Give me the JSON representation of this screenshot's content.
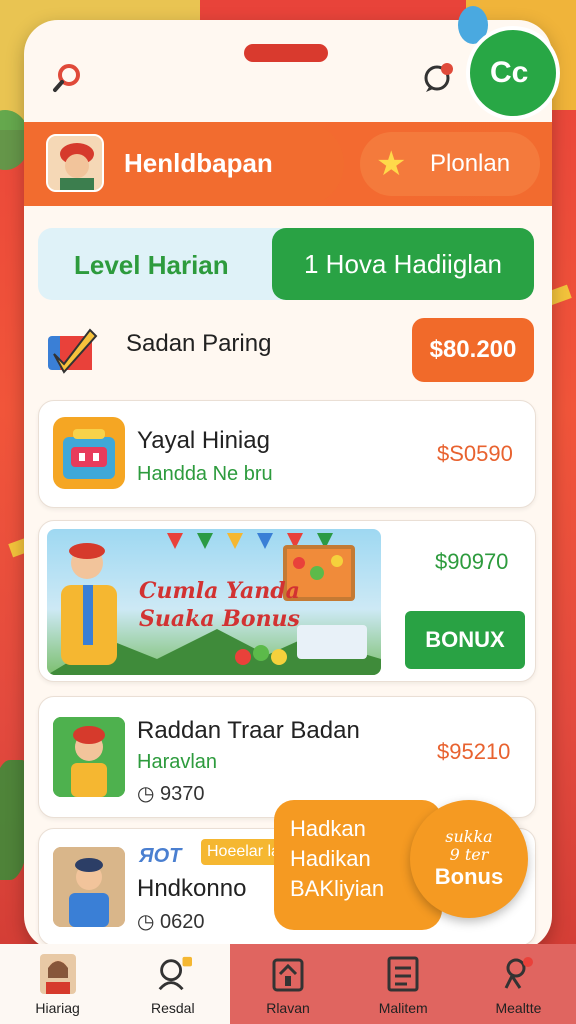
{
  "topbar": {
    "search_icon": "search-icon",
    "chat_icon": "chat-icon"
  },
  "header": {
    "title": "Henldbapan",
    "right_label": "Plonlan"
  },
  "level": {
    "label": "Level Harian",
    "reward_button": "1 Hova Hadiiglan"
  },
  "daily": {
    "title": "Sadan Paring",
    "price": "$80.200"
  },
  "items": [
    {
      "title": "Yayal Hiniag",
      "subtitle": "Handda Ne bru",
      "price": "$S0590"
    },
    {
      "title": "Raddan Traar Badan",
      "subtitle": "Haravlan",
      "count": "9370",
      "price": "$95210"
    },
    {
      "tag_hot": "ЯOT",
      "tag_label": "Hoeelar lar",
      "title": "Hndkonno",
      "count": "0620"
    }
  ],
  "banner": {
    "line1": "Cumla Yanda",
    "line2": "Suaka Bonus",
    "price": "$90970",
    "button": "BONUX"
  },
  "promo": {
    "line1": "Hadkan",
    "line2": "Hadikan",
    "line3": "BAKliyian",
    "circle_small1": "sukka",
    "circle_small2": "9 ter",
    "circle_big": "Bonus"
  },
  "corner_badge": "Cc",
  "nav": [
    {
      "label": "Hiariag",
      "icon": "profile-icon"
    },
    {
      "label": "Resdal",
      "icon": "user-icon"
    },
    {
      "label": "Rlavan",
      "icon": "home-icon"
    },
    {
      "label": "Malitem",
      "icon": "document-icon"
    },
    {
      "label": "Mealtte",
      "icon": "people-icon"
    }
  ],
  "colors": {
    "accent_orange": "#f26c2f",
    "accent_green": "#29a244",
    "background_red": "#e8433a"
  }
}
